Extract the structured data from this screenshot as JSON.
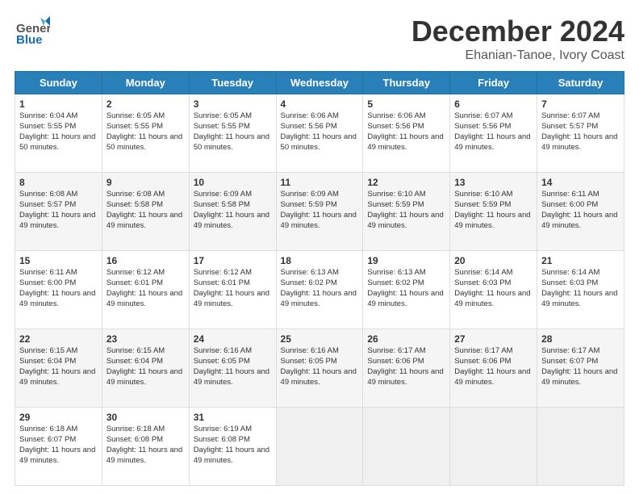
{
  "header": {
    "logo_general": "General",
    "logo_blue": "Blue",
    "month_title": "December 2024",
    "subtitle": "Ehanian-Tanoe, Ivory Coast"
  },
  "days_of_week": [
    "Sunday",
    "Monday",
    "Tuesday",
    "Wednesday",
    "Thursday",
    "Friday",
    "Saturday"
  ],
  "weeks": [
    [
      {
        "day": "1",
        "sunrise": "6:04 AM",
        "sunset": "5:55 PM",
        "daylight": "11 hours and 50 minutes."
      },
      {
        "day": "2",
        "sunrise": "6:05 AM",
        "sunset": "5:55 PM",
        "daylight": "11 hours and 50 minutes."
      },
      {
        "day": "3",
        "sunrise": "6:05 AM",
        "sunset": "5:55 PM",
        "daylight": "11 hours and 50 minutes."
      },
      {
        "day": "4",
        "sunrise": "6:06 AM",
        "sunset": "5:56 PM",
        "daylight": "11 hours and 50 minutes."
      },
      {
        "day": "5",
        "sunrise": "6:06 AM",
        "sunset": "5:56 PM",
        "daylight": "11 hours and 49 minutes."
      },
      {
        "day": "6",
        "sunrise": "6:07 AM",
        "sunset": "5:56 PM",
        "daylight": "11 hours and 49 minutes."
      },
      {
        "day": "7",
        "sunrise": "6:07 AM",
        "sunset": "5:57 PM",
        "daylight": "11 hours and 49 minutes."
      }
    ],
    [
      {
        "day": "8",
        "sunrise": "6:08 AM",
        "sunset": "5:57 PM",
        "daylight": "11 hours and 49 minutes."
      },
      {
        "day": "9",
        "sunrise": "6:08 AM",
        "sunset": "5:58 PM",
        "daylight": "11 hours and 49 minutes."
      },
      {
        "day": "10",
        "sunrise": "6:09 AM",
        "sunset": "5:58 PM",
        "daylight": "11 hours and 49 minutes."
      },
      {
        "day": "11",
        "sunrise": "6:09 AM",
        "sunset": "5:59 PM",
        "daylight": "11 hours and 49 minutes."
      },
      {
        "day": "12",
        "sunrise": "6:10 AM",
        "sunset": "5:59 PM",
        "daylight": "11 hours and 49 minutes."
      },
      {
        "day": "13",
        "sunrise": "6:10 AM",
        "sunset": "5:59 PM",
        "daylight": "11 hours and 49 minutes."
      },
      {
        "day": "14",
        "sunrise": "6:11 AM",
        "sunset": "6:00 PM",
        "daylight": "11 hours and 49 minutes."
      }
    ],
    [
      {
        "day": "15",
        "sunrise": "6:11 AM",
        "sunset": "6:00 PM",
        "daylight": "11 hours and 49 minutes."
      },
      {
        "day": "16",
        "sunrise": "6:12 AM",
        "sunset": "6:01 PM",
        "daylight": "11 hours and 49 minutes."
      },
      {
        "day": "17",
        "sunrise": "6:12 AM",
        "sunset": "6:01 PM",
        "daylight": "11 hours and 49 minutes."
      },
      {
        "day": "18",
        "sunrise": "6:13 AM",
        "sunset": "6:02 PM",
        "daylight": "11 hours and 49 minutes."
      },
      {
        "day": "19",
        "sunrise": "6:13 AM",
        "sunset": "6:02 PM",
        "daylight": "11 hours and 49 minutes."
      },
      {
        "day": "20",
        "sunrise": "6:14 AM",
        "sunset": "6:03 PM",
        "daylight": "11 hours and 49 minutes."
      },
      {
        "day": "21",
        "sunrise": "6:14 AM",
        "sunset": "6:03 PM",
        "daylight": "11 hours and 49 minutes."
      }
    ],
    [
      {
        "day": "22",
        "sunrise": "6:15 AM",
        "sunset": "6:04 PM",
        "daylight": "11 hours and 49 minutes."
      },
      {
        "day": "23",
        "sunrise": "6:15 AM",
        "sunset": "6:04 PM",
        "daylight": "11 hours and 49 minutes."
      },
      {
        "day": "24",
        "sunrise": "6:16 AM",
        "sunset": "6:05 PM",
        "daylight": "11 hours and 49 minutes."
      },
      {
        "day": "25",
        "sunrise": "6:16 AM",
        "sunset": "6:05 PM",
        "daylight": "11 hours and 49 minutes."
      },
      {
        "day": "26",
        "sunrise": "6:17 AM",
        "sunset": "6:06 PM",
        "daylight": "11 hours and 49 minutes."
      },
      {
        "day": "27",
        "sunrise": "6:17 AM",
        "sunset": "6:06 PM",
        "daylight": "11 hours and 49 minutes."
      },
      {
        "day": "28",
        "sunrise": "6:17 AM",
        "sunset": "6:07 PM",
        "daylight": "11 hours and 49 minutes."
      }
    ],
    [
      {
        "day": "29",
        "sunrise": "6:18 AM",
        "sunset": "6:07 PM",
        "daylight": "11 hours and 49 minutes."
      },
      {
        "day": "30",
        "sunrise": "6:18 AM",
        "sunset": "6:08 PM",
        "daylight": "11 hours and 49 minutes."
      },
      {
        "day": "31",
        "sunrise": "6:19 AM",
        "sunset": "6:08 PM",
        "daylight": "11 hours and 49 minutes."
      },
      null,
      null,
      null,
      null
    ]
  ]
}
